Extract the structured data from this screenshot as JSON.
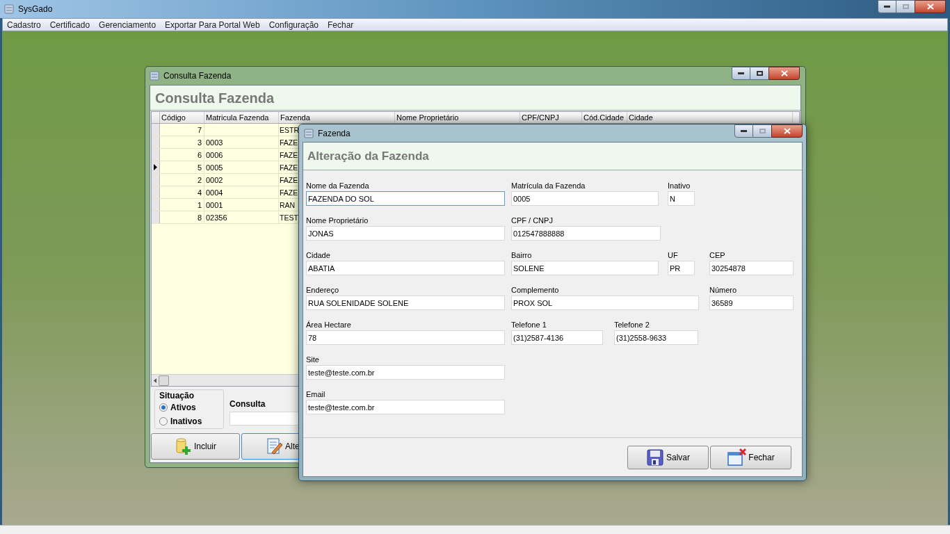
{
  "app_window": {
    "title": "SysGado"
  },
  "menu": [
    "Cadastro",
    "Certificado",
    "Gerenciamento",
    "Exportar Para Portal Web",
    "Configuração",
    "Fechar"
  ],
  "consulta_window": {
    "title": "Consulta Fazenda",
    "heading": "Consulta Fazenda",
    "table": {
      "columns": [
        "Código",
        "Matricula Fazenda",
        "Fazenda",
        "Nome Proprietário",
        "CPF/CNPJ",
        "Cód.Cidade",
        "Cidade"
      ],
      "rows": [
        {
          "codigo": "7",
          "matricula": "",
          "fazenda": "ESTR",
          "selected": false
        },
        {
          "codigo": "3",
          "matricula": "0003",
          "fazenda": "FAZE",
          "selected": false
        },
        {
          "codigo": "6",
          "matricula": "0006",
          "fazenda": "FAZE",
          "selected": false
        },
        {
          "codigo": "5",
          "matricula": "0005",
          "fazenda": "FAZE",
          "selected": true
        },
        {
          "codigo": "2",
          "matricula": "0002",
          "fazenda": "FAZE",
          "selected": false
        },
        {
          "codigo": "4",
          "matricula": "0004",
          "fazenda": "FAZE",
          "selected": false
        },
        {
          "codigo": "1",
          "matricula": "0001",
          "fazenda": "RAN",
          "selected": false
        },
        {
          "codigo": "8",
          "matricula": "02356",
          "fazenda": "TEST",
          "selected": false
        }
      ]
    },
    "situacao": {
      "label": "Situação",
      "options": [
        {
          "label": "Ativos",
          "selected": true
        },
        {
          "label": "Inativos",
          "selected": false
        }
      ]
    },
    "consulta": {
      "label": "Consulta"
    },
    "buttons": [
      {
        "kind": "add",
        "label": "Incluir"
      },
      {
        "kind": "edit",
        "label": "Alte"
      }
    ]
  },
  "fazenda_window": {
    "title": "Fazenda",
    "heading": "Alteração da Fazenda",
    "fields": [
      {
        "label": "Nome da Fazenda",
        "value": "FAZENDA DO SOL",
        "focused": true
      },
      {
        "label": "Matrícula da Fazenda",
        "value": "0005",
        "focused": false
      },
      {
        "label": "Inativo",
        "value": "N",
        "focused": false
      },
      {
        "label": "Nome Proprietário",
        "value": "JONAS",
        "focused": false
      },
      {
        "label": "CPF / CNPJ",
        "value": "012547888888",
        "focused": false
      },
      {
        "label": "Cidade",
        "value": "ABATIA",
        "focused": false
      },
      {
        "label": "Bairro",
        "value": "SOLENE",
        "focused": false
      },
      {
        "label": "UF",
        "value": "PR",
        "focused": false
      },
      {
        "label": "CEP",
        "value": "30254878",
        "focused": false
      },
      {
        "label": "Endereço",
        "value": "RUA SOLENIDADE SOLENE",
        "focused": false
      },
      {
        "label": "Complemento",
        "value": "PROX SOL",
        "focused": false
      },
      {
        "label": "Número",
        "value": "36589",
        "focused": false
      },
      {
        "label": "Área Hectare",
        "value": "78",
        "focused": false
      },
      {
        "label": "Telefone 1",
        "value": "(31)2587-4136",
        "focused": false
      },
      {
        "label": "Telefone 2",
        "value": "(31)2558-9633",
        "focused": false
      },
      {
        "label": "Site",
        "value": "teste@teste.com.br",
        "focused": false
      },
      {
        "label": "Email",
        "value": "teste@teste.com.br",
        "focused": false
      }
    ],
    "buttons": [
      {
        "kind": "save",
        "label": "Salvar"
      },
      {
        "kind": "close",
        "label": "Fechar"
      }
    ]
  }
}
